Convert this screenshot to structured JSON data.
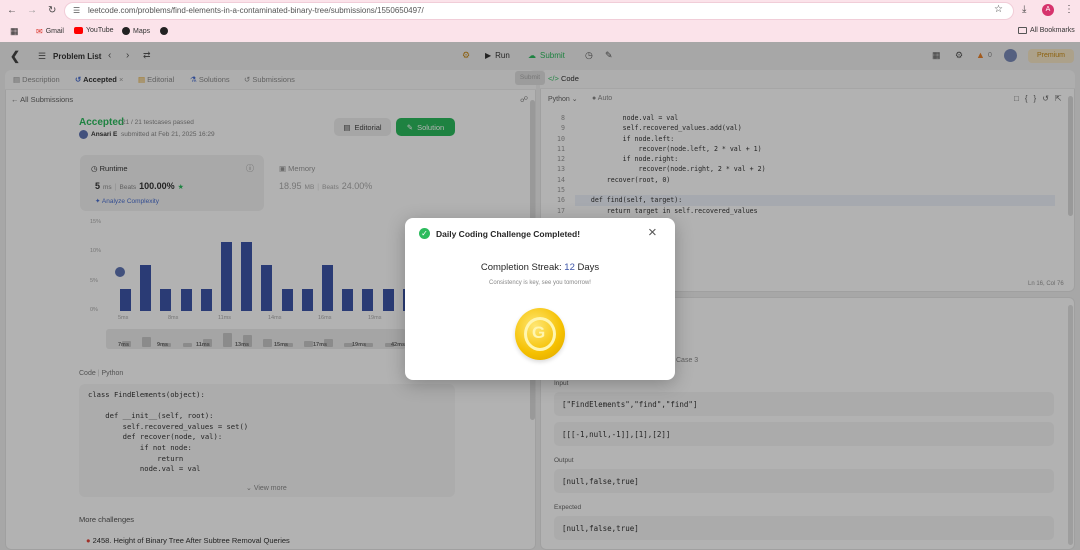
{
  "browser": {
    "url": "leetcode.com/problems/find-elements-in-a-contaminated-binary-tree/submissions/1550650497/",
    "bookmarks": [
      "Gmail",
      "YouTube",
      "Maps"
    ],
    "all_bookmarks": "All Bookmarks",
    "profile_initial": "A"
  },
  "lc": {
    "problem_list": "Problem List",
    "run": "Run",
    "submit": "Submit",
    "premium": "Premium",
    "streak_small": "0"
  },
  "left_tabs": [
    "Description",
    "Accepted",
    "Editorial",
    "Solutions",
    "Submissions"
  ],
  "right_tabs": {
    "submit_ghost": "Submit",
    "code": "Code"
  },
  "submission": {
    "back": "All Submissions",
    "status": "Accepted",
    "testcases": "21 / 21 testcases passed",
    "author": "Ansari E",
    "submitted": "submitted at Feb 21, 2025 16:29",
    "editorial_btn": "Editorial",
    "solution_btn": "Solution",
    "runtime_label": "Runtime",
    "runtime_value": "5",
    "runtime_unit": "ms",
    "beats_label": "Beats",
    "runtime_beats": "100.00%",
    "analyze": "Analyze Complexity",
    "memory_label": "Memory",
    "memory_value": "18.95",
    "memory_unit": "MB",
    "memory_beats": "24.00%"
  },
  "chart_data": {
    "type": "bar",
    "ytick_labels": [
      "15%",
      "10%",
      "5%",
      "0%"
    ],
    "categories": [
      "5ms",
      "6ms",
      "7ms",
      "8ms",
      "9ms",
      "10ms",
      "11ms",
      "12ms",
      "13ms",
      "14ms",
      "15ms",
      "16ms",
      "17ms",
      "18ms",
      "19ms"
    ],
    "values": [
      3.8,
      7.8,
      3.8,
      3.8,
      3.8,
      11.8,
      11.8,
      7.8,
      3.8,
      3.8,
      7.8,
      3.8,
      3.8,
      3.8,
      3.8
    ],
    "xtick_labels": [
      "5ms",
      "8ms",
      "11ms",
      "14ms",
      "16ms",
      "19ms",
      "22ms"
    ],
    "navigator_labels": [
      "7ms",
      "9ms",
      "11ms",
      "13ms",
      "15ms",
      "17ms",
      "19ms",
      "42ms"
    ],
    "ylim": [
      0,
      15
    ]
  },
  "code_section": {
    "label": "Code",
    "lang": "Python",
    "lines": [
      "class FindElements(object):",
      "",
      "    def __init__(self, root):",
      "        self.recovered_values = set()",
      "        def recover(node, val):",
      "            if not node:",
      "                return",
      "            node.val = val"
    ],
    "view_more": "View more"
  },
  "more_challenges": {
    "title": "More challenges",
    "item": "2458. Height of Binary Tree After Subtree Removal Queries"
  },
  "editor": {
    "lang": "Python",
    "mode": "Auto",
    "line_numbers": [
      "8",
      "9",
      "10",
      "11",
      "12",
      "13",
      "14",
      "15",
      "16",
      "17"
    ],
    "lines": [
      "            node.val = val",
      "            self.recovered_values.add(val)",
      "            if node.left:",
      "                recover(node.left, 2 * val + 1)",
      "            if node.right:",
      "                recover(node.right, 2 * val + 2)",
      "        recover(root, 0)",
      "",
      "    def find(self, target):",
      "        return target in self.recovered_values"
    ],
    "cursor": "Ln 16, Col 76"
  },
  "testcase": {
    "case_label": "Case 3",
    "input_label": "Input",
    "input1": "[\"FindElements\",\"find\",\"find\"]",
    "input2": "[[[-1,null,-1]],[1],[2]]",
    "output_label": "Output",
    "output": "[null,false,true]",
    "expected_label": "Expected",
    "expected": "[null,false,true]"
  },
  "modal": {
    "title": "Daily Coding Challenge Completed!",
    "streak_label": "Completion Streak:",
    "streak_value": "12",
    "streak_unit": "Days",
    "subtitle": "Consistency is key, see you tomorrow!",
    "coin_icon": "leetcode-coin-icon"
  },
  "colors": {
    "accent_green": "#2cbb5d",
    "bar_blue": "#3d55a8",
    "modal_check": "#2cbb5d"
  }
}
